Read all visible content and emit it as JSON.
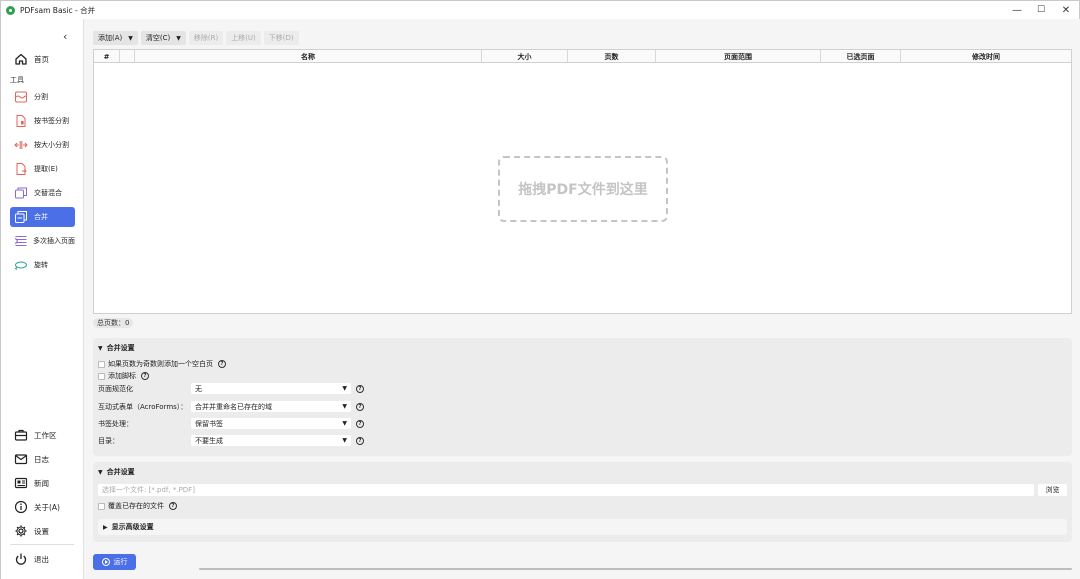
{
  "window": {
    "title": "PDFsam Basic - 合并",
    "controls": [
      "—",
      "☐",
      "✕"
    ]
  },
  "sidebar": {
    "collapse_icon": "‹",
    "home": {
      "label": "首页",
      "icon": "home-icon"
    },
    "tools_label": "工具",
    "tools": [
      {
        "label": "分割",
        "icon": "split-icon"
      },
      {
        "label": "按书签分割",
        "icon": "split-bookmarks-icon"
      },
      {
        "label": "按大小分割",
        "icon": "split-size-icon"
      },
      {
        "label": "提取(E)",
        "icon": "extract-icon"
      },
      {
        "label": "交替混合",
        "icon": "alternate-mix-icon"
      },
      {
        "label": "合并",
        "icon": "merge-icon",
        "active": true
      },
      {
        "label": "多次插入页面",
        "icon": "insert-pages-icon"
      },
      {
        "label": "旋转",
        "icon": "rotate-icon"
      }
    ],
    "bottom": [
      {
        "label": "工作区",
        "icon": "workspace-icon"
      },
      {
        "label": "日志",
        "icon": "log-icon"
      },
      {
        "label": "新闻",
        "icon": "news-icon"
      },
      {
        "label": "关于(A)",
        "icon": "about-icon"
      },
      {
        "label": "设置",
        "icon": "settings-icon"
      }
    ],
    "exit": {
      "label": "退出",
      "icon": "exit-icon"
    }
  },
  "toolbar": {
    "add": "添加(A)",
    "clear": "清空(C)",
    "remove": "移除(R)",
    "move_up": "上移(U)",
    "move_down": "下移(D)",
    "dropdown_glyph": "▼"
  },
  "table": {
    "columns": [
      "#",
      "",
      "名称",
      "大小",
      "页数",
      "页面范围",
      "已选页面",
      "修改时间"
    ],
    "dropzone_text": "拖拽PDF文件到这里"
  },
  "status": {
    "page_count": "总页数：0"
  },
  "merge_settings": {
    "title": "合并设置",
    "blank_page_checkbox": "如果页数为奇数则添加一个空白页",
    "footer_checkbox": "添加脚标",
    "help_glyph": "?",
    "rows": [
      {
        "label": "页面规范化",
        "value": "无"
      },
      {
        "label": "互动式表单（AcroForms）：",
        "value": "合并并重命名已存在的域"
      },
      {
        "label": "书签处理：",
        "value": "保留书签"
      },
      {
        "label": "目录：",
        "value": "不要生成"
      }
    ]
  },
  "output_settings": {
    "title": "合并设置",
    "destination_placeholder": "选择一个文件: [*.pdf, *.PDF]",
    "browse_label": "浏览",
    "overwrite_checkbox": "覆盖已存在的文件",
    "advanced_label": "显示高级设置"
  },
  "run": {
    "label": "运行"
  },
  "progress": {
    "value": 0
  }
}
